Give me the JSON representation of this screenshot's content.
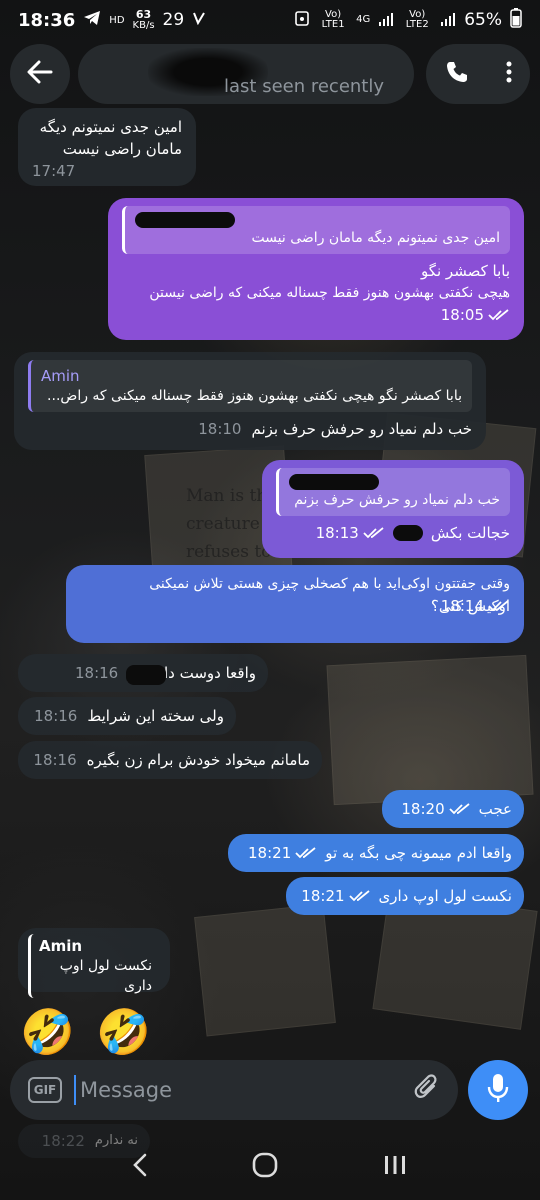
{
  "status_bar": {
    "time": "18:36",
    "net_speed_value": "63",
    "net_speed_unit": "KB/s",
    "notif_count": "29",
    "sim1_label": "Vo) LTE1",
    "sim1_type": "4G",
    "sim2_label": "Vo) LTE2",
    "battery": "65%"
  },
  "header": {
    "status": "last seen recently"
  },
  "messages": [
    {
      "text_line1": "امین جدی نمیتونم دیگه",
      "text_line2": "مامان راضی نیست",
      "time": "17:47"
    },
    {
      "reply_text": "امین جدی نمیتونم دیگه مامان راضی نیست",
      "text_line1": "بابا کصشر نگو",
      "text_line2": "هیچی نکفتی بهشون هنوز فقط چسناله میکنی که راضی نیستن",
      "time": "18:05"
    },
    {
      "reply_name": "Amin",
      "reply_text": "بابا کصشر نگو هیچی نکفتی بهشون هنوز فقط چسناله میکنی که راض...",
      "text": "خب دلم نمیاد رو حرفش حرف بزنم",
      "time": "18:10"
    },
    {
      "reply_text": "خب دلم نمیاد رو حرفش حرف بزنم",
      "text": "خجالت بکش",
      "time": "18:13"
    },
    {
      "text_line1": "وقتی جفتتون اوکی‌اید با هم کصخلی چیزی هستی تلاش نمیکنی",
      "text_line2": "اوکیش کنی؟",
      "time": "18:14"
    },
    {
      "text": "واقعا دوست دارم  رو",
      "time": "18:16"
    },
    {
      "text": "ولی سخته این شرایط",
      "time": "18:16"
    },
    {
      "text": "مامانم میخواد خودش برام زن بگیره",
      "time": "18:16"
    },
    {
      "text": "عجب",
      "time": "18:20"
    },
    {
      "text": "واقعا ادم میمونه چی بگه به تو",
      "time": "18:21"
    },
    {
      "text": "نکست لول اوپ داری",
      "time": "18:21"
    },
    {
      "reply_name": "Amin",
      "reply_text": "نکست لول اوپ داری"
    },
    {
      "text": "نه ندارم",
      "time": "18:22"
    }
  ],
  "emojis": [
    "🤣",
    "🤣"
  ],
  "input": {
    "gif_label": "GIF",
    "placeholder": "Message"
  },
  "colors": {
    "accent": "#3e8ef7",
    "bubble_in": "#24292e",
    "bubble_purple": "#8a4fd6",
    "bubble_blue": "#3f7fe0"
  },
  "icons": {
    "back": "arrow-left-icon",
    "call": "phone-icon",
    "menu": "more-vertical-icon",
    "attach": "paperclip-icon",
    "mic": "microphone-icon"
  }
}
